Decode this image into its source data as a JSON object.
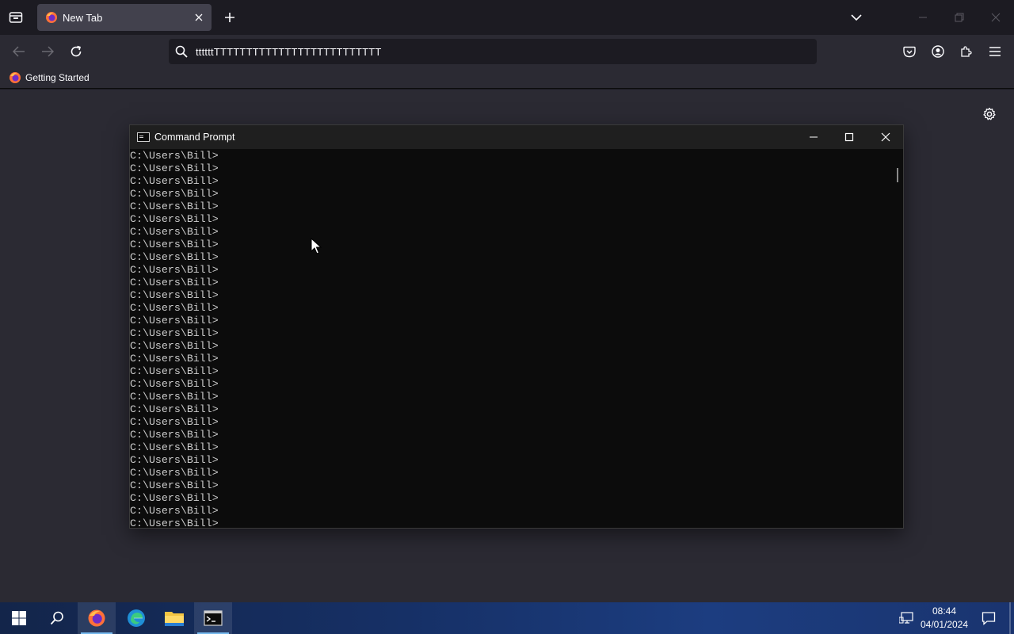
{
  "browser": {
    "tab": {
      "title": "New Tab"
    },
    "url_text": "ttttttTTTTTTTTTTTTTTTTTTTTTTTTTT",
    "bookmark": {
      "label": "Getting Started"
    }
  },
  "cmd": {
    "title": "Command Prompt",
    "lines": [
      "C:\\Users\\Bill>",
      "C:\\Users\\Bill>",
      "C:\\Users\\Bill>",
      "C:\\Users\\Bill>",
      "C:\\Users\\Bill>",
      "C:\\Users\\Bill>",
      "C:\\Users\\Bill>",
      "C:\\Users\\Bill>",
      "C:\\Users\\Bill>",
      "C:\\Users\\Bill>",
      "C:\\Users\\Bill>",
      "C:\\Users\\Bill>",
      "C:\\Users\\Bill>",
      "C:\\Users\\Bill>",
      "C:\\Users\\Bill>",
      "C:\\Users\\Bill>",
      "C:\\Users\\Bill>",
      "C:\\Users\\Bill>",
      "C:\\Users\\Bill>",
      "C:\\Users\\Bill>",
      "C:\\Users\\Bill>",
      "C:\\Users\\Bill>",
      "C:\\Users\\Bill>",
      "C:\\Users\\Bill>",
      "C:\\Users\\Bill>",
      "C:\\Users\\Bill>",
      "C:\\Users\\Bill>",
      "C:\\Users\\Bill>",
      "C:\\Users\\Bill>",
      "C:\\Users\\Bill>"
    ]
  },
  "taskbar": {
    "time": "08:44",
    "date": "04/01/2024",
    "apps": [
      "start-icon",
      "search-icon",
      "firefox-icon",
      "edge-icon",
      "file-explorer-icon",
      "command-prompt-icon"
    ]
  },
  "colors": {
    "accent": "#76b9ed",
    "chrome_bg": "#1c1b22",
    "toolbar_bg": "#2b2a33"
  }
}
